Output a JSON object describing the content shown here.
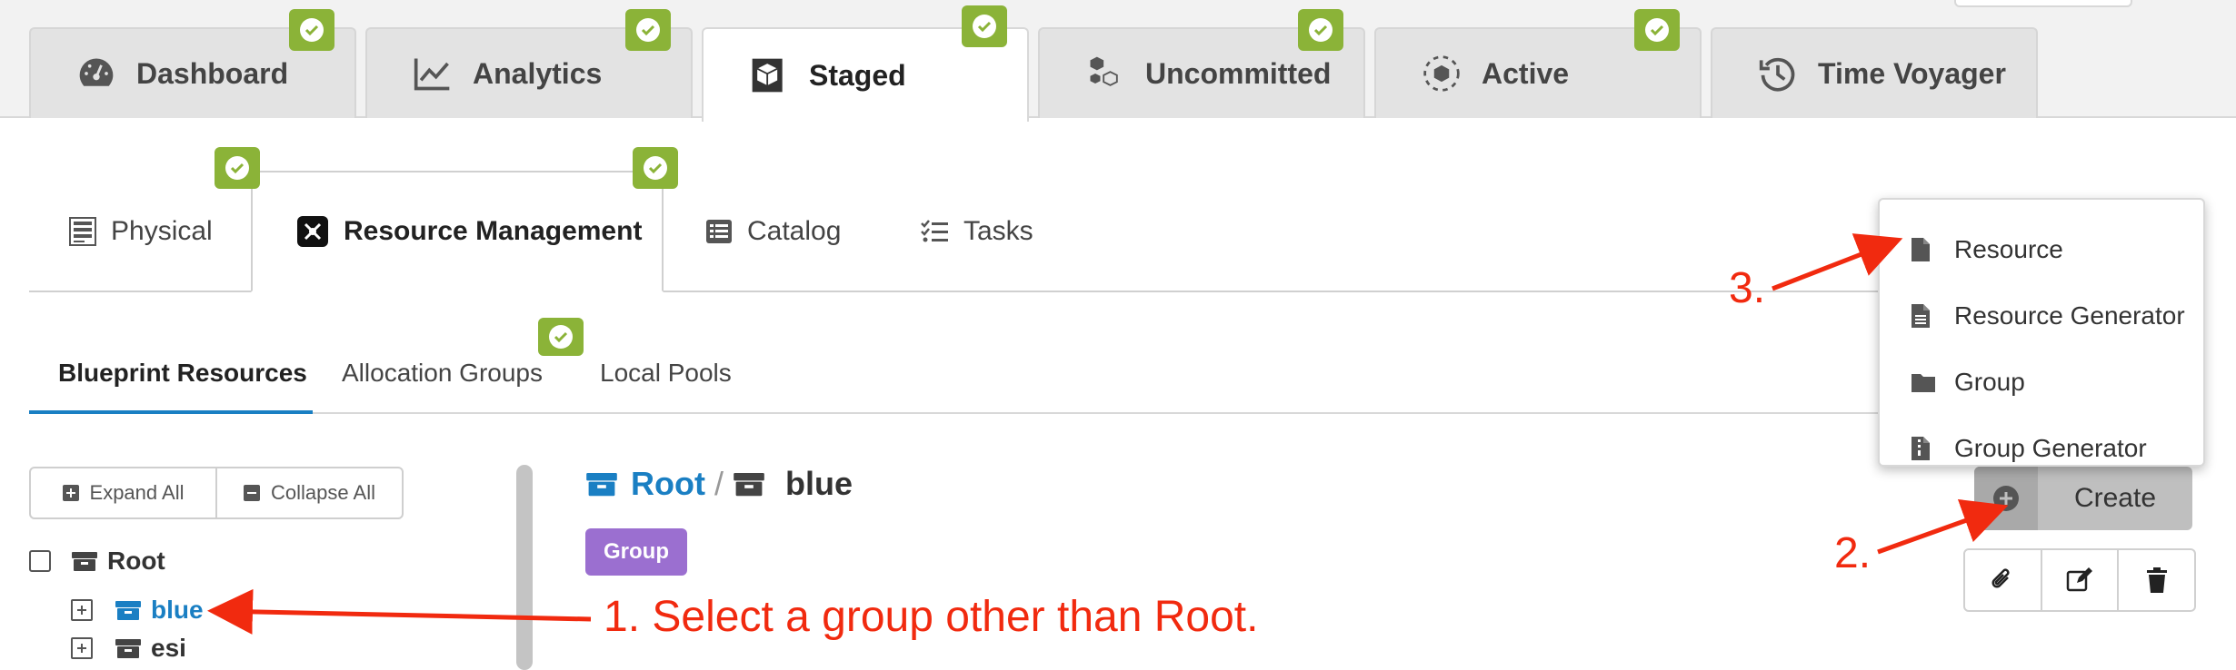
{
  "top_tabs": [
    {
      "label": "Dashboard",
      "icon": "gauge-icon",
      "badge": true
    },
    {
      "label": "Analytics",
      "icon": "chart-line-icon",
      "badge": true
    },
    {
      "label": "Staged",
      "icon": "staged-cube-icon",
      "badge": true,
      "active": true
    },
    {
      "label": "Uncommitted",
      "icon": "cubes-icon",
      "badge": true
    },
    {
      "label": "Active",
      "icon": "active-cube-icon",
      "badge": true
    },
    {
      "label": "Time Voyager",
      "icon": "history-icon",
      "badge": false
    }
  ],
  "sub_tabs": [
    {
      "label": "Physical",
      "icon": "server-icon"
    },
    {
      "label": "Resource Management",
      "icon": "resource-icon",
      "active": true
    },
    {
      "label": "Catalog",
      "icon": "list-icon"
    },
    {
      "label": "Tasks",
      "icon": "tasks-icon"
    }
  ],
  "resource_tabs": [
    {
      "label": "Blueprint Resources",
      "active": true
    },
    {
      "label": "Allocation Groups"
    },
    {
      "label": "Local Pools"
    }
  ],
  "tree": {
    "expand_all": "Expand All",
    "collapse_all": "Collapse All",
    "root_label": "Root",
    "children": [
      {
        "label": "blue",
        "selected": true
      },
      {
        "label": "esi"
      }
    ]
  },
  "breadcrumb": {
    "root": "Root",
    "separator": "/",
    "current": "blue"
  },
  "group_badge": "Group",
  "create_button": "Create",
  "dropdown": {
    "items": [
      {
        "label": "Resource",
        "icon": "file-icon"
      },
      {
        "label": "Resource Generator",
        "icon": "file-text-icon"
      },
      {
        "label": "Group",
        "icon": "folder-icon"
      },
      {
        "label": "Group Generator",
        "icon": "file-zip-icon"
      }
    ]
  },
  "annotations": {
    "step1": "1. Select a group other than Root.",
    "step2": "2.",
    "step3": "3."
  },
  "colors": {
    "badge_green": "#8bb338",
    "link_blue": "#1a7fc3",
    "group_purple": "#9b6fd0",
    "annotation_red": "#f12a0f"
  }
}
